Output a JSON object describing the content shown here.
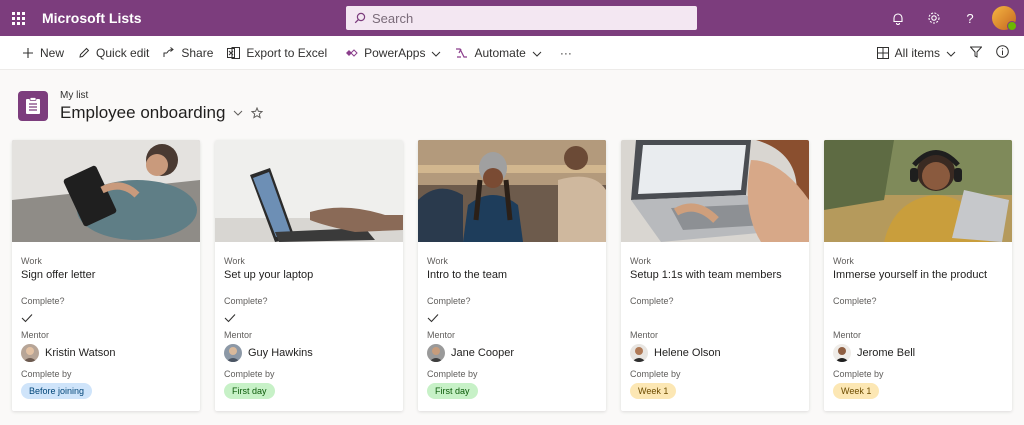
{
  "app": {
    "title": "Microsoft Lists"
  },
  "search": {
    "placeholder": "Search"
  },
  "suite_icons": [
    "bell-icon",
    "gear-icon",
    "help-icon"
  ],
  "command_bar": {
    "new": "New",
    "quick_edit": "Quick edit",
    "share": "Share",
    "export": "Export to Excel",
    "powerapps": "PowerApps",
    "automate": "Automate",
    "more": "···",
    "view": "All items"
  },
  "list": {
    "parent": "My list",
    "title": "Employee onboarding"
  },
  "fields": {
    "work": "Work",
    "complete": "Complete?",
    "mentor": "Mentor",
    "complete_by": "Complete by"
  },
  "cards": [
    {
      "work": "Sign offer letter",
      "complete": true,
      "mentor": "Kristin Watson",
      "complete_by": "Before joining",
      "status_color": "blue"
    },
    {
      "work": "Set up your laptop",
      "complete": true,
      "mentor": "Guy Hawkins",
      "complete_by": "First day",
      "status_color": "green"
    },
    {
      "work": "Intro to the team",
      "complete": true,
      "mentor": "Jane Cooper",
      "complete_by": "First day",
      "status_color": "green"
    },
    {
      "work": "Setup 1:1s with team members",
      "complete": false,
      "mentor": "Helene Olson",
      "complete_by": "Week 1",
      "status_color": "yellow"
    },
    {
      "work": "Immerse yourself in the product",
      "complete": false,
      "mentor": "Jerome Bell",
      "complete_by": "Week 1",
      "status_color": "yellow"
    }
  ],
  "colors": {
    "brand": "#7c3d7d",
    "accent": "#8b3e8c"
  }
}
